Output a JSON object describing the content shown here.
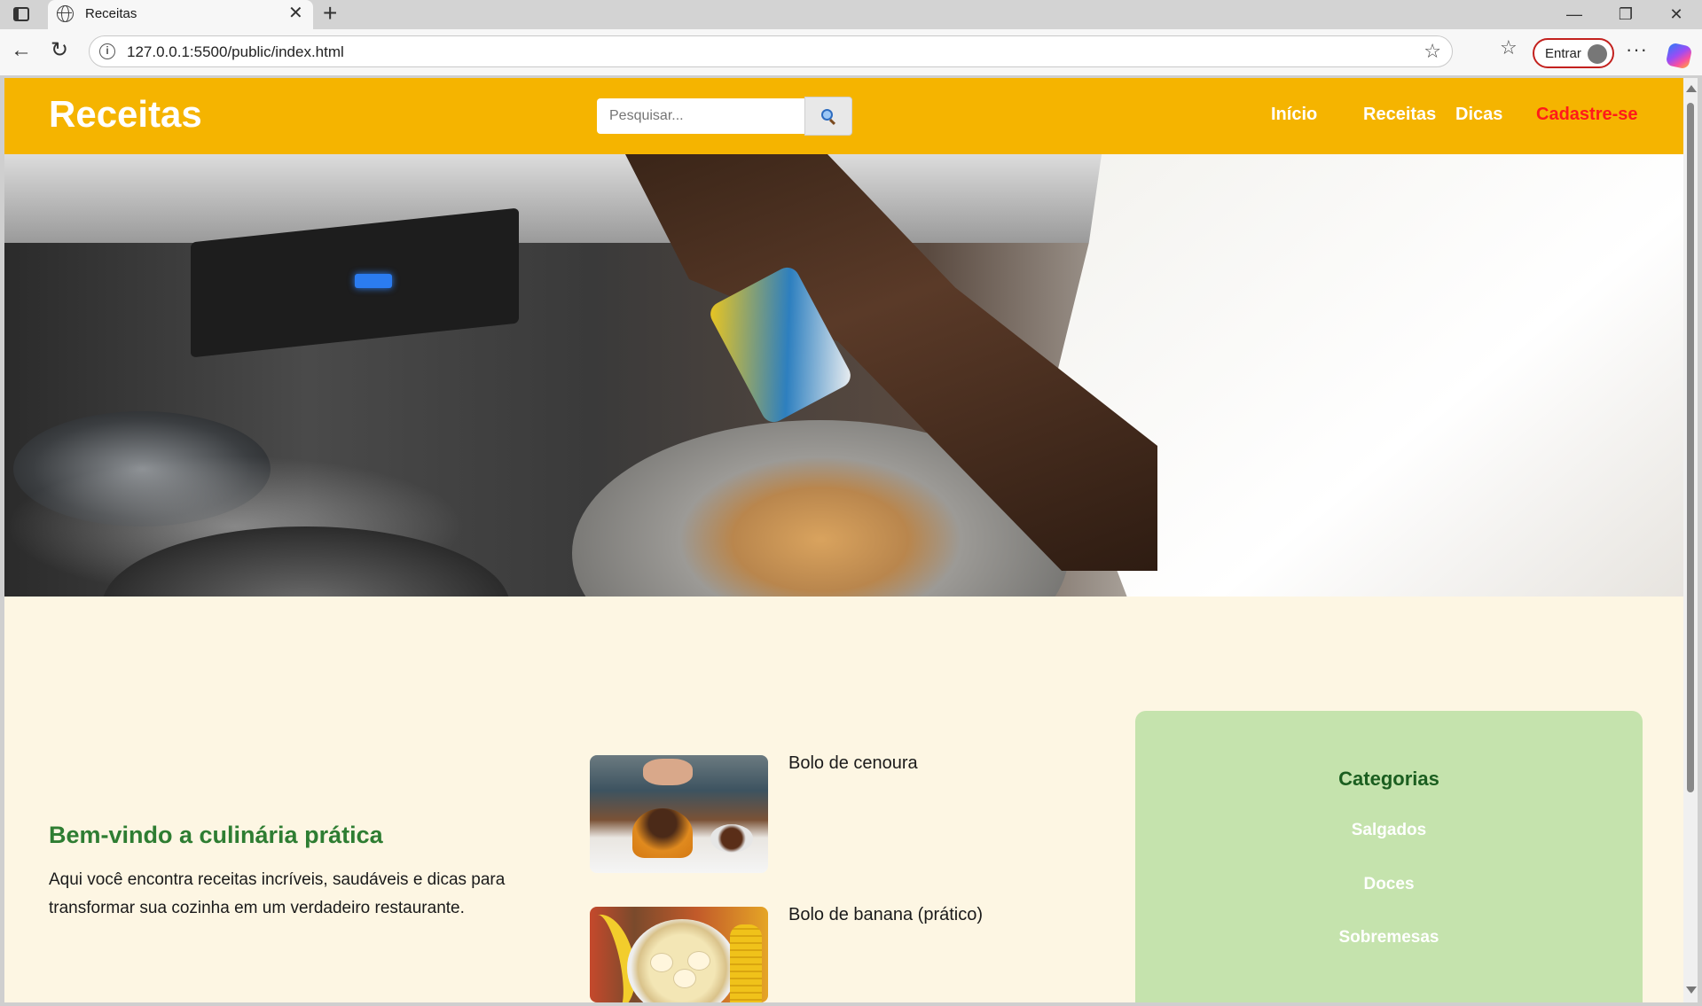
{
  "browser": {
    "tab_title": "Receitas",
    "tab_close": "✕",
    "new_tab": "+",
    "url": "127.0.0.1:5500/public/index.html",
    "signin_label": "Entrar",
    "window_controls": {
      "minimize": "—",
      "restore": "❐",
      "close": "✕"
    },
    "icons": [
      "tab-actions-icon",
      "globe-icon",
      "back-arrow-icon",
      "reload-icon",
      "info-icon",
      "star-icon",
      "favorites-icon",
      "profile-avatar-icon",
      "more-options-icon",
      "copilot-icon"
    ]
  },
  "site": {
    "logo": "Receitas",
    "search": {
      "placeholder": "Pesquisar..."
    },
    "nav": [
      {
        "label": "Início"
      },
      {
        "label": "Receitas"
      },
      {
        "label": "Dicas"
      },
      {
        "label": "Cadastre-se"
      }
    ],
    "welcome": {
      "title": "Bem-vindo a culinária prática",
      "text": "Aqui você encontra receitas incríveis, saudáveis e dicas para transformar sua cozinha em um verdadeiro restaurante."
    },
    "recipes": [
      {
        "name": "Bolo de cenoura"
      },
      {
        "name": "Bolo de banana (prático)"
      }
    ],
    "categories": {
      "title": "Categorias",
      "items": [
        "Salgados",
        "Doces",
        "Sobremesas"
      ]
    },
    "colors": {
      "header_bg": "#f5b400",
      "page_bg": "#fdf6e3",
      "signup_link": "#ff1a1a",
      "welcome_title": "#2e7d32",
      "categories_bg": "#c5e3ad",
      "categories_title": "#1b5e20"
    }
  }
}
